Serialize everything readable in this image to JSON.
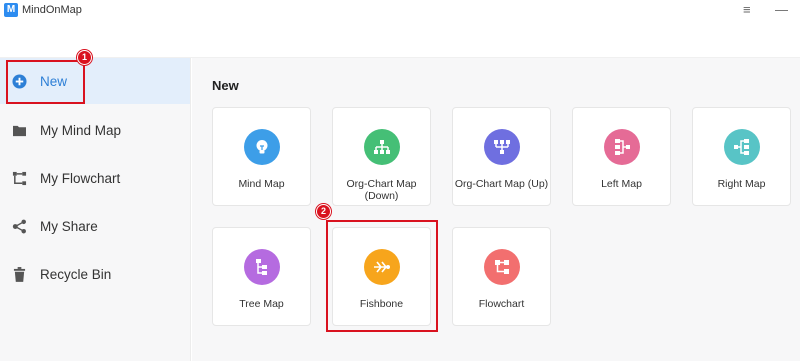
{
  "window": {
    "title": "MindOnMap",
    "logo_letter": "M",
    "menu_glyph": "≡",
    "minimize_glyph": "—"
  },
  "sidebar": {
    "items": [
      {
        "label": "New",
        "icon": "plus-circle-icon",
        "selected": true
      },
      {
        "label": "My Mind Map",
        "icon": "folder-icon"
      },
      {
        "label": "My Flowchart",
        "icon": "flowchart-icon"
      },
      {
        "label": "My Share",
        "icon": "share-icon"
      },
      {
        "label": "Recycle Bin",
        "icon": "trash-icon"
      }
    ]
  },
  "main": {
    "section_title": "New",
    "templates": [
      {
        "label": "Mind Map",
        "icon": "lightbulb-icon",
        "color": "#3d9ee8"
      },
      {
        "label": "Org-Chart Map (Down)",
        "icon": "org-chart-down-icon",
        "color": "#45bf76"
      },
      {
        "label": "Org-Chart Map (Up)",
        "icon": "org-chart-up-icon",
        "color": "#6f6fe0"
      },
      {
        "label": "Left Map",
        "icon": "left-map-icon",
        "color": "#e56b96"
      },
      {
        "label": "Right Map",
        "icon": "right-map-icon",
        "color": "#58c4c6"
      },
      {
        "label": "Tree Map",
        "icon": "tree-map-icon",
        "color": "#b56be0"
      },
      {
        "label": "Fishbone",
        "icon": "fishbone-icon",
        "color": "#f7a51c"
      },
      {
        "label": "Flowchart",
        "icon": "flowchart-icon",
        "color": "#f26f6f"
      }
    ]
  },
  "annotations": {
    "badge1": "1",
    "badge2": "2",
    "highlight_color": "#d9121f"
  }
}
